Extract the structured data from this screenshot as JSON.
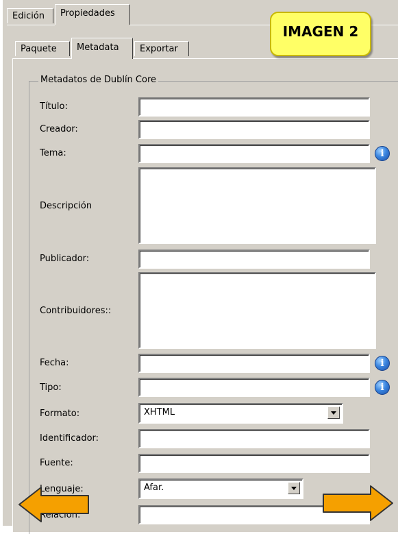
{
  "tabs_top": {
    "edicion": "Edición",
    "propiedades": "Propiedades"
  },
  "tabs_sub": {
    "paquete": "Paquete",
    "metadata": "Metadata",
    "exportar": "Exportar"
  },
  "annotation": "IMAGEN 2",
  "fieldset_legend": "Metadatos de Dublín Core",
  "fields": {
    "titulo": {
      "label": "Título:",
      "value": ""
    },
    "creador": {
      "label": "Creador:",
      "value": ""
    },
    "tema": {
      "label": "Tema:",
      "value": ""
    },
    "descripcion": {
      "label": "Descripción",
      "value": ""
    },
    "publicador": {
      "label": "Publicador:",
      "value": ""
    },
    "contribuidores": {
      "label": "Contribuidores::",
      "value": ""
    },
    "fecha": {
      "label": "Fecha:",
      "value": ""
    },
    "tipo": {
      "label": "Tipo:",
      "value": ""
    },
    "formato": {
      "label": "Formato:",
      "selected": "XHTML"
    },
    "identificador": {
      "label": "Identificador:",
      "value": ""
    },
    "fuente": {
      "label": "Fuente:",
      "value": ""
    },
    "lenguaje": {
      "label": "Lenguaje:",
      "selected": "Afar."
    },
    "relacion": {
      "label": "Relación:",
      "value": ""
    }
  },
  "info_icon_glyph": "i",
  "colors": {
    "arrow_fill": "#f5a000",
    "arrow_stroke": "#333333",
    "note_bg": "#ffff66"
  }
}
